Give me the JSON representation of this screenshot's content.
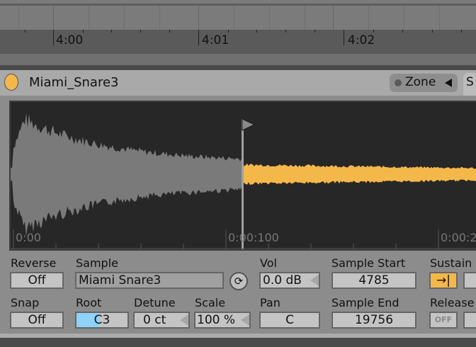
{
  "arrangement": {
    "ruler_labels": [
      "4:00",
      "4:01",
      "4:02"
    ]
  },
  "clip": {
    "title": "Miami_Snare3",
    "color": "#f4b84a",
    "zone_label": "Zone",
    "next_tab_partial": "S"
  },
  "waveform": {
    "time_labels": [
      "0:00",
      "0:00:100",
      "0:00:2"
    ],
    "played_color": "#7a7a7a",
    "active_color": "#f4b84a"
  },
  "controls": {
    "reverse": {
      "label": "Reverse",
      "value": "Off"
    },
    "snap": {
      "label": "Snap",
      "value": "Off"
    },
    "sample": {
      "label": "Sample",
      "value": "Miami Snare3"
    },
    "root": {
      "label": "Root",
      "value": "C3"
    },
    "detune": {
      "label": "Detune",
      "value": "0 ct"
    },
    "scale": {
      "label": "Scale",
      "value": "100 %"
    },
    "vol": {
      "label": "Vol",
      "value": "0.0 dB"
    },
    "pan": {
      "label": "Pan",
      "value": "C"
    },
    "sample_start": {
      "label": "Sample Start",
      "value": "4785"
    },
    "sample_end": {
      "label": "Sample End",
      "value": "19756"
    },
    "sustain": {
      "label": "Sustain",
      "value": "→|"
    },
    "release": {
      "label": "Release",
      "value": "OFF"
    }
  }
}
